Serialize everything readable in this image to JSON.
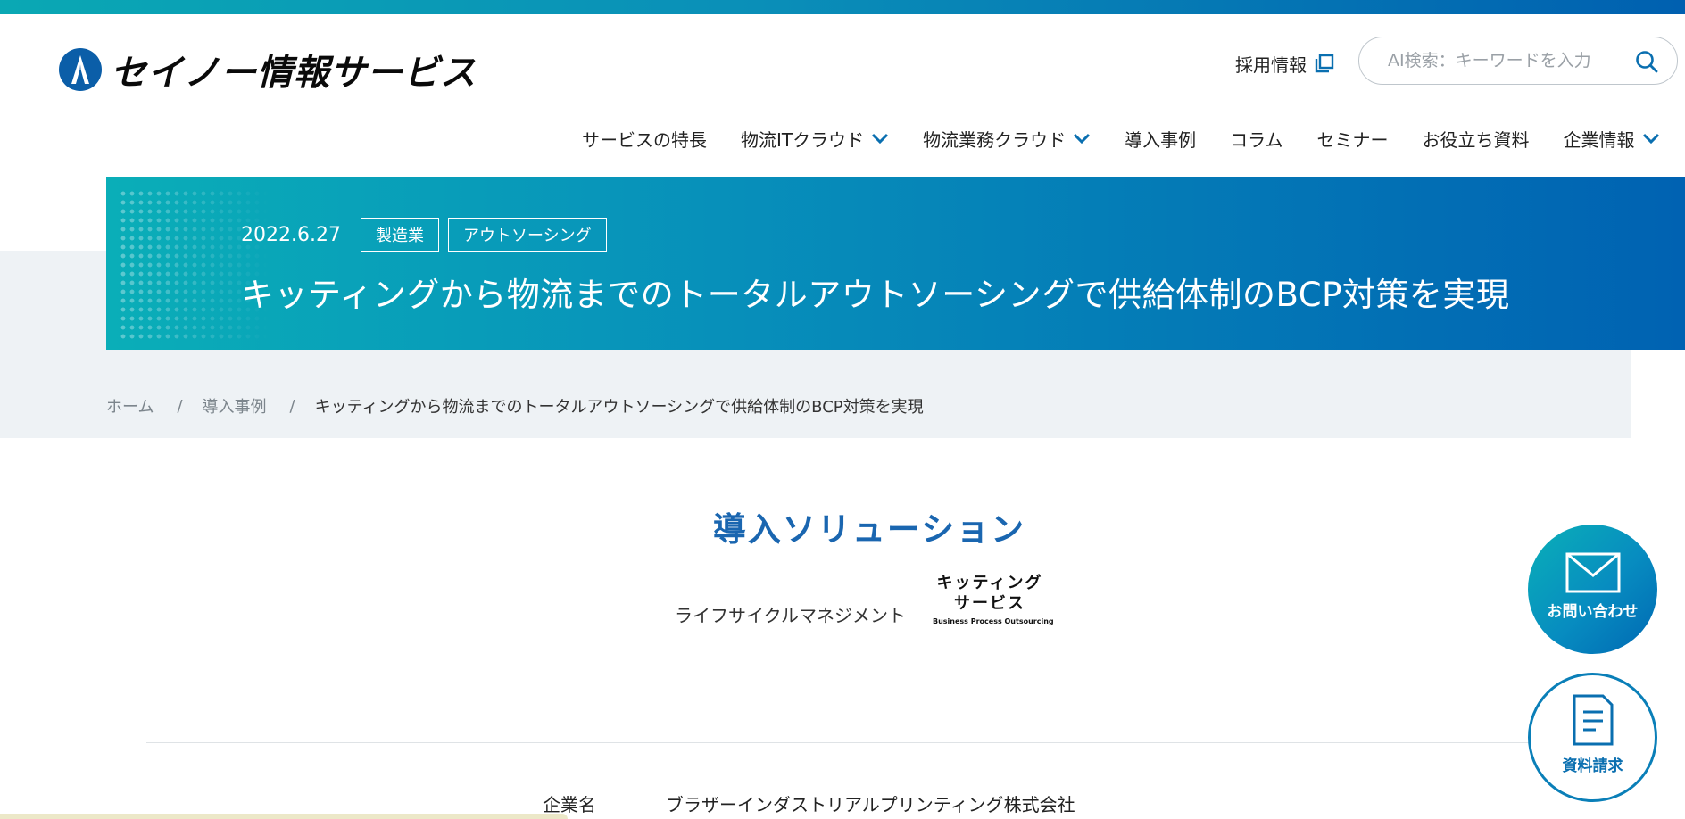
{
  "brand": {
    "name": "セイノー情報サービス",
    "accent_color": "#0b5ea8"
  },
  "header": {
    "recruit_label": "採用情報",
    "search": {
      "placeholder": "AI検索：キーワードを入力"
    }
  },
  "nav": {
    "items": [
      {
        "label": "サービスの特長",
        "has_dropdown": false
      },
      {
        "label": "物流ITクラウド",
        "has_dropdown": true
      },
      {
        "label": "物流業務クラウド",
        "has_dropdown": true
      },
      {
        "label": "導入事例",
        "has_dropdown": false
      },
      {
        "label": "コラム",
        "has_dropdown": false
      },
      {
        "label": "セミナー",
        "has_dropdown": false
      },
      {
        "label": "お役立ち資料",
        "has_dropdown": false
      },
      {
        "label": "企業情報",
        "has_dropdown": true
      }
    ]
  },
  "hero": {
    "date": "2022.6.27",
    "tags": [
      "製造業",
      "アウトソーシング"
    ],
    "title": "キッティングから物流までのトータルアウトソーシングで供給体制のBCP対策を実現"
  },
  "breadcrumb": {
    "items": [
      "ホーム",
      "導入事例"
    ],
    "separator": "/",
    "current": "キッティングから物流までのトータルアウトソーシングで供給体制のBCP対策を実現"
  },
  "solution": {
    "title": "導入ソリューション",
    "label": "ライフサイクルマネジメント",
    "logo_line1": "キッティング",
    "logo_line2": "サービス",
    "logo_sub": "Business Process Outsourcing"
  },
  "company": {
    "key": "企業名",
    "value": "ブラザーインダストリアルプリンティング株式会社"
  },
  "floating": {
    "contact_label": "お問い合わせ",
    "document_label": "資料請求"
  }
}
